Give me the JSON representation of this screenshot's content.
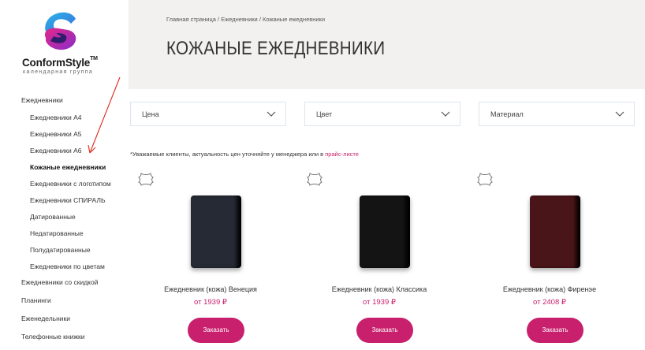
{
  "brand": {
    "name": "ConformStyle",
    "trademark": "TM",
    "tagline": "календарная группа"
  },
  "sidebar": {
    "items": [
      {
        "label": "Ежедневники",
        "level": 1,
        "active": false
      },
      {
        "label": "Ежедневники А4",
        "level": 2,
        "active": false
      },
      {
        "label": "Ежедневники А5",
        "level": 2,
        "active": false
      },
      {
        "label": "Ежедневники А6",
        "level": 2,
        "active": false
      },
      {
        "label": "Кожаные ежедневники",
        "level": 2,
        "active": true
      },
      {
        "label": "Ежедневники с логотипом",
        "level": 2,
        "active": false
      },
      {
        "label": "Ежедневники СПИРАЛЬ",
        "level": 2,
        "active": false
      },
      {
        "label": "Датированные",
        "level": 2,
        "active": false
      },
      {
        "label": "Недатированные",
        "level": 2,
        "active": false
      },
      {
        "label": "Полудатированные",
        "level": 2,
        "active": false
      },
      {
        "label": "Ежедневники по цветам",
        "level": 2,
        "active": false
      },
      {
        "label": "Ежедневники со скидкой",
        "level": 1,
        "active": false
      },
      {
        "label": "Планинги",
        "level": 1,
        "active": false
      },
      {
        "label": "Еженедельники",
        "level": 1,
        "active": false
      },
      {
        "label": "Телефонные книжки",
        "level": 1,
        "active": false
      }
    ]
  },
  "breadcrumb": {
    "home": "Главная страница",
    "sep": " / ",
    "section": "Ежедневники",
    "current": "Кожаные ежедневники"
  },
  "page_title": "КОЖАНЫЕ ЕЖЕДНЕВНИКИ",
  "filters": [
    {
      "label": "Цена"
    },
    {
      "label": "Цвет"
    },
    {
      "label": "Материал"
    }
  ],
  "notice": {
    "text": "*Уважаемые клиенты, актуальность цен уточняйте у менеджера или в ",
    "link": "прайс-листе"
  },
  "products": [
    {
      "name": "Ежедневник (кожа) Венеция",
      "price": "от 1939 ₽",
      "button": "Заказать",
      "color": "#262a35"
    },
    {
      "name": "Ежедневник (кожа) Классика",
      "price": "от 1939 ₽",
      "button": "Заказать",
      "color": "#141414"
    },
    {
      "name": "Ежедневник (кожа) Фиренэе",
      "price": "от 2408 ₽",
      "button": "Заказать",
      "color": "#4a1518"
    }
  ],
  "colors": {
    "accent": "#c8206d",
    "header_bg": "#f3f1ef",
    "annotation_arrow": "#e0362c"
  }
}
